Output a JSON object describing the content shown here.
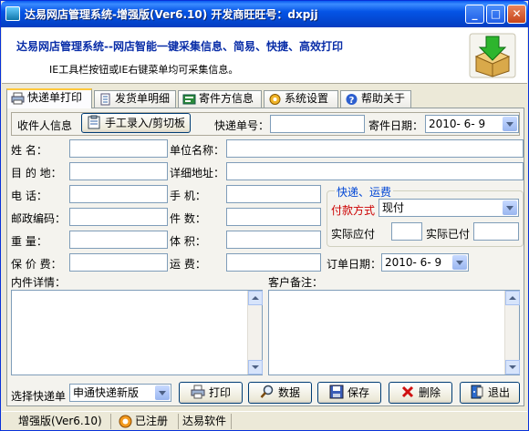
{
  "window": {
    "title": "达易网店管理系统-增强版(Ver6.10)  开发商旺旺号：dxpjj"
  },
  "banner": {
    "title": "达易网店管理系统--网店智能一键采集信息、简易、快捷、高效打印",
    "subtitle": "IE工具栏按钮或IE右键菜单均可采集信息。"
  },
  "tabs": [
    {
      "label": "快递单打印",
      "icon": "print-icon"
    },
    {
      "label": "发货单明细",
      "icon": "document-icon"
    },
    {
      "label": "寄件方信息",
      "icon": "sender-icon"
    },
    {
      "label": "系统设置",
      "icon": "settings-icon"
    },
    {
      "label": "帮助关于",
      "icon": "help-icon"
    }
  ],
  "top": {
    "recipient_label": "收件人信息",
    "manual_btn": "手工录入/剪切板",
    "tracking_label": "快递单号：",
    "tracking_value": "",
    "send_date_label": "寄件日期：",
    "send_date_value": "2010- 6- 9"
  },
  "form": {
    "name_label": "姓    名：",
    "company_label": "单位名称：",
    "region_label": "目 的 地：",
    "address_label": "详细地址：",
    "phone_label": "电    话：",
    "mobile_label": "手    机：",
    "zip_label": "邮政编码：",
    "count_label": "件    数：",
    "weight_label": "重    量：",
    "volume_label": "体    积：",
    "insure_label": "保 价 费：",
    "freight_label": "运    费：",
    "order_date_label": "订单日期：",
    "order_date_value": "2010- 6- 9",
    "content_label": "内件详情：",
    "remark_label": "客户备注："
  },
  "freight_group": {
    "title": "快递、运费",
    "pay_label": "付款方式",
    "pay_value": "现付",
    "due_label": "实际应付",
    "paid_label": "实际已付"
  },
  "bottom": {
    "select_label": "选择快递单",
    "select_value": "申通快递新版",
    "print": "打印",
    "data": "数据",
    "save": "保存",
    "delete": "删除",
    "exit": "退出"
  },
  "status": {
    "edition": "增强版(Ver6.10)",
    "registered": "已注册",
    "vendor": "达易软件"
  },
  "colors": {
    "title_bar": "#0554e6",
    "banner_title": "#0a2ea8",
    "group_title": "#0046d5",
    "pay_label": "#cc0000"
  }
}
